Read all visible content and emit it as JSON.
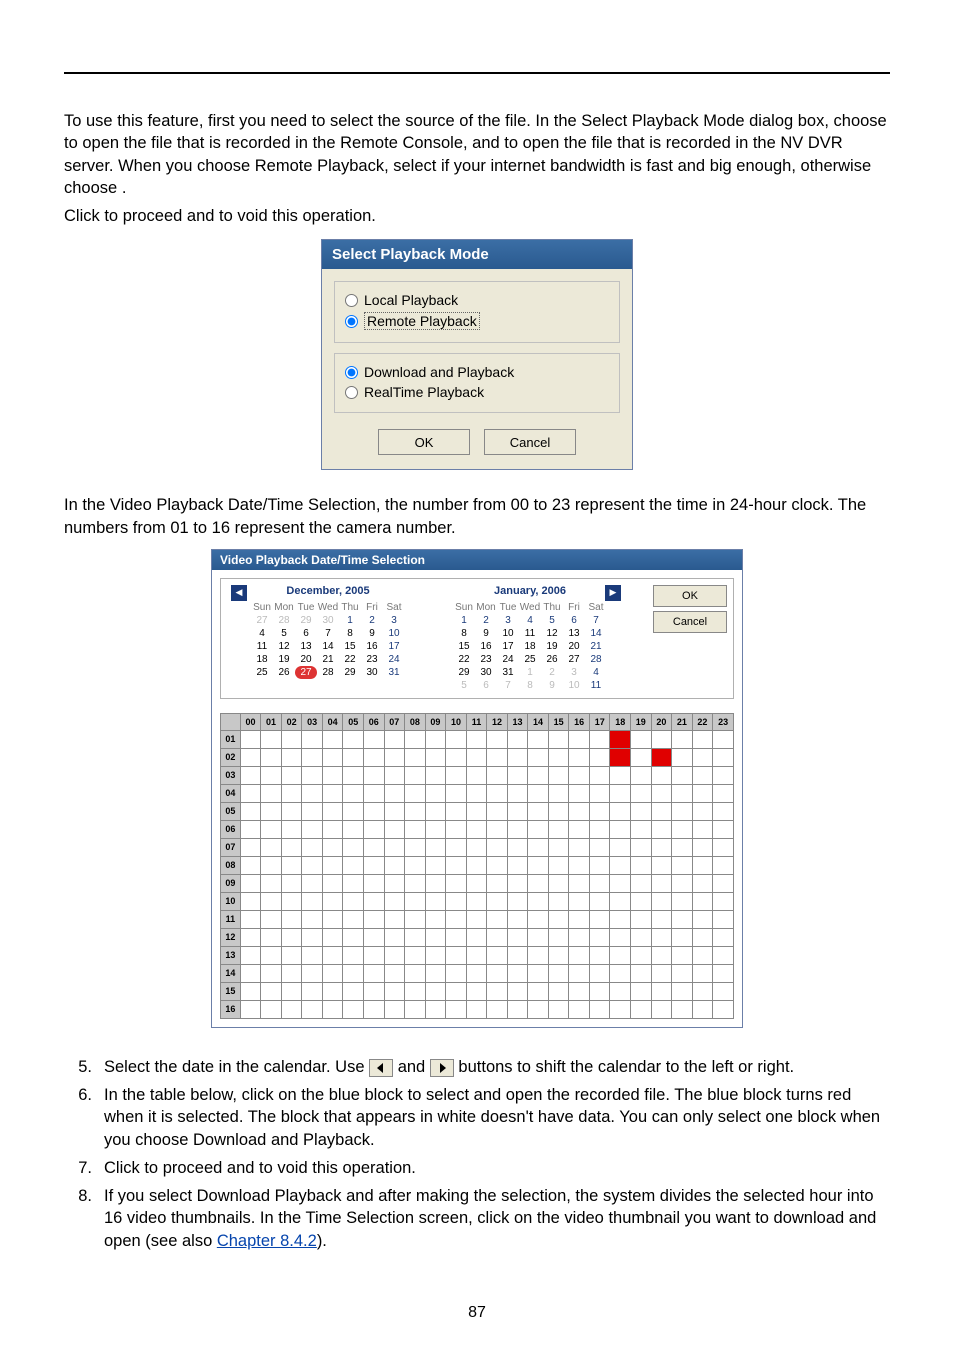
{
  "para1": {
    "a": "To use this feature, first you need to select the source of the file. In the Select Playback Mode dialog box, choose",
    "b": "to open the file that is recorded in the Remote Console, and",
    "c": "to open the file that is recorded in the NV DVR server. When you choose Remote Playback, select",
    "d": "if your internet bandwidth is fast and big enough, otherwise choose",
    "e": "."
  },
  "para2": {
    "a": "Click",
    "b": "to proceed and",
    "c": "to void this operation."
  },
  "dialog": {
    "title": "Select Playback Mode",
    "opt_local": "Local Playback",
    "opt_remote": "Remote Playback",
    "opt_dl": "Download and Playback",
    "opt_rt": "RealTime Playback",
    "ok": "OK",
    "cancel": "Cancel"
  },
  "para3": "In the Video Playback Date/Time Selection, the number from 00 to 23 represent the time in 24-hour clock. The numbers from 01 to 16 represent the camera number.",
  "vpd": {
    "title": "Video Playback Date/Time Selection",
    "ok": "OK",
    "cancel": "Cancel",
    "cal_left": {
      "month": "December, 2005",
      "dow": [
        "Sun",
        "Mon",
        "Tue",
        "Wed",
        "Thu",
        "Fri",
        "Sat"
      ],
      "weeks": [
        [
          {
            "d": "27",
            "dim": 1
          },
          {
            "d": "28",
            "dim": 1
          },
          {
            "d": "29",
            "dim": 1
          },
          {
            "d": "30",
            "dim": 1
          },
          {
            "d": "1",
            "s": 1
          },
          {
            "d": "2",
            "s": 1
          },
          {
            "d": "3",
            "s": 1
          }
        ],
        [
          {
            "d": "4"
          },
          {
            "d": "5"
          },
          {
            "d": "6"
          },
          {
            "d": "7"
          },
          {
            "d": "8"
          },
          {
            "d": "9"
          },
          {
            "d": "10"
          }
        ],
        [
          {
            "d": "11"
          },
          {
            "d": "12"
          },
          {
            "d": "13"
          },
          {
            "d": "14"
          },
          {
            "d": "15"
          },
          {
            "d": "16"
          },
          {
            "d": "17"
          }
        ],
        [
          {
            "d": "18"
          },
          {
            "d": "19"
          },
          {
            "d": "20"
          },
          {
            "d": "21"
          },
          {
            "d": "22"
          },
          {
            "d": "23"
          },
          {
            "d": "24"
          }
        ],
        [
          {
            "d": "25"
          },
          {
            "d": "26"
          },
          {
            "d": "27",
            "today": 1
          },
          {
            "d": "28"
          },
          {
            "d": "29"
          },
          {
            "d": "30"
          },
          {
            "d": "31"
          }
        ]
      ]
    },
    "cal_right": {
      "month": "January, 2006",
      "dow": [
        "Sun",
        "Mon",
        "Tue",
        "Wed",
        "Thu",
        "Fri",
        "Sat"
      ],
      "weeks": [
        [
          {
            "d": "1",
            "s": 1
          },
          {
            "d": "2",
            "s": 1
          },
          {
            "d": "3",
            "s": 1
          },
          {
            "d": "4",
            "s": 1
          },
          {
            "d": "5",
            "s": 1
          },
          {
            "d": "6",
            "s": 1
          },
          {
            "d": "7",
            "s": 1
          }
        ],
        [
          {
            "d": "8"
          },
          {
            "d": "9"
          },
          {
            "d": "10"
          },
          {
            "d": "11"
          },
          {
            "d": "12"
          },
          {
            "d": "13"
          },
          {
            "d": "14"
          }
        ],
        [
          {
            "d": "15"
          },
          {
            "d": "16"
          },
          {
            "d": "17"
          },
          {
            "d": "18"
          },
          {
            "d": "19"
          },
          {
            "d": "20"
          },
          {
            "d": "21"
          }
        ],
        [
          {
            "d": "22"
          },
          {
            "d": "23"
          },
          {
            "d": "24"
          },
          {
            "d": "25"
          },
          {
            "d": "26"
          },
          {
            "d": "27"
          },
          {
            "d": "28"
          }
        ],
        [
          {
            "d": "29"
          },
          {
            "d": "30"
          },
          {
            "d": "31"
          },
          {
            "d": "1",
            "dim": 1
          },
          {
            "d": "2",
            "dim": 1
          },
          {
            "d": "3",
            "dim": 1
          },
          {
            "d": "4",
            "dim": 1
          }
        ],
        [
          {
            "d": "5",
            "dim": 1
          },
          {
            "d": "6",
            "dim": 1
          },
          {
            "d": "7",
            "dim": 1
          },
          {
            "d": "8",
            "dim": 1
          },
          {
            "d": "9",
            "dim": 1
          },
          {
            "d": "10",
            "dim": 1
          },
          {
            "d": "11",
            "dim": 1
          }
        ]
      ]
    },
    "hours": [
      "00",
      "01",
      "02",
      "03",
      "04",
      "05",
      "06",
      "07",
      "08",
      "09",
      "10",
      "11",
      "12",
      "13",
      "14",
      "15",
      "16",
      "17",
      "18",
      "19",
      "20",
      "21",
      "22",
      "23"
    ],
    "cams": [
      "01",
      "02",
      "03",
      "04",
      "05",
      "06",
      "07",
      "08",
      "09",
      "10",
      "11",
      "12",
      "13",
      "14",
      "15",
      "16"
    ],
    "red_cells": [
      {
        "r": 0,
        "c": 18
      },
      {
        "r": 1,
        "c": 18
      },
      {
        "r": 1,
        "c": 20
      }
    ]
  },
  "steps": {
    "s5": {
      "a": "Select the date in the calendar. Use",
      "b": "and",
      "c": "buttons to shift the calendar to the left or right."
    },
    "s6": "In the table below, click on the blue block to select and open the recorded file. The blue block turns red when it is selected. The block that appears in white doesn't have data. You can only select one block when you choose Download and Playback.",
    "s7": {
      "a": "Click",
      "b": "to proceed and",
      "c": "to void this operation."
    },
    "s8": {
      "a": "If you select Download Playback and after making the selection, the system divides the selected hour into 16 video thumbnails. In the Time Selection screen, click on the video thumbnail you want to download and open (see also ",
      "link": "Chapter 8.4.2",
      "b": ")."
    }
  },
  "pagenum": "87"
}
